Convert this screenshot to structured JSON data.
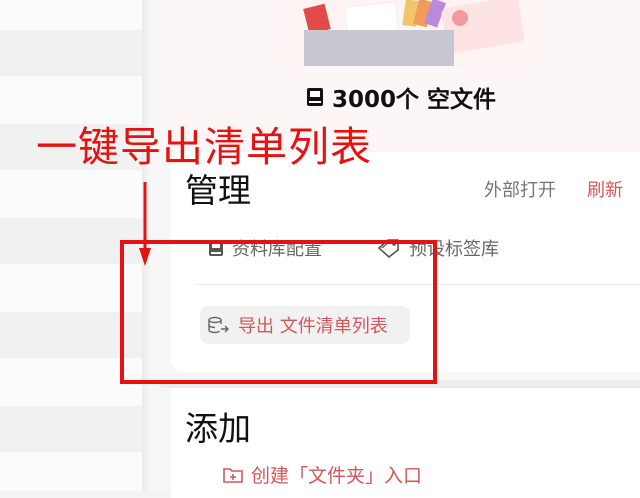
{
  "header": {
    "file_count": "3000个 空文件"
  },
  "annotation": {
    "text": "一键导出清单列表"
  },
  "manage": {
    "title": "管理",
    "external_open": "外部打开",
    "refresh": "刷新",
    "library_config": "资料库配置",
    "preset_tags": "预设标签库",
    "export_list": "导出 文件清单列表"
  },
  "add": {
    "title": "添加",
    "create_folder_entry": "创建「文件夹」入口"
  },
  "icons": {
    "count": "book-icon",
    "library_config": "book-icon",
    "preset_tags": "tag-icon",
    "export_list": "database-export-icon",
    "create_folder_entry": "folder-plus-icon"
  },
  "colors": {
    "annotation_red": "#e51212",
    "accent": "#d45757"
  }
}
